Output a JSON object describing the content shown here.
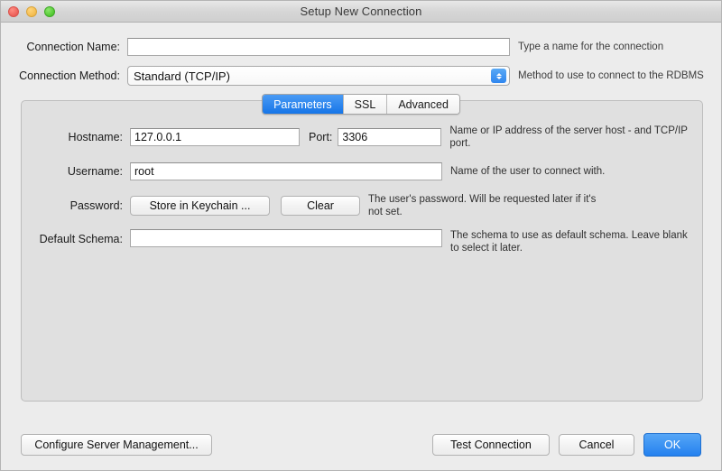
{
  "window": {
    "title": "Setup New Connection",
    "traffic_lights": [
      "close-button",
      "minimize-button",
      "maximize-button"
    ]
  },
  "form": {
    "connection_name": {
      "label": "Connection Name:",
      "value": "",
      "placeholder": "",
      "hint": "Type a name for the connection"
    },
    "connection_method": {
      "label": "Connection Method:",
      "value": "Standard (TCP/IP)",
      "hint": "Method to use to connect to the RDBMS",
      "options": [
        "Standard (TCP/IP)"
      ]
    }
  },
  "tabs": [
    {
      "label": "Parameters",
      "active": true
    },
    {
      "label": "SSL",
      "active": false
    },
    {
      "label": "Advanced",
      "active": false
    }
  ],
  "parameters": {
    "hostname": {
      "label": "Hostname:",
      "value": "127.0.0.1",
      "placeholder": ""
    },
    "port": {
      "label": "Port:",
      "value": "3306",
      "placeholder": "",
      "hint": "Name or IP address of the server host - and TCP/IP port."
    },
    "username": {
      "label": "Username:",
      "value": "root",
      "placeholder": "",
      "hint": "Name of the user to connect with."
    },
    "password": {
      "label": "Password:",
      "store_button": "Store in Keychain ...",
      "clear_button": "Clear",
      "hint": "The user's password. Will be requested later if it's not set."
    },
    "default_schema": {
      "label": "Default Schema:",
      "value": "",
      "placeholder": "",
      "hint": "The schema to use as default schema. Leave blank to select it later."
    }
  },
  "footer": {
    "configure_server": "Configure Server Management...",
    "test_connection": "Test Connection",
    "cancel": "Cancel",
    "ok": "OK"
  },
  "colors": {
    "accent_blue": "#2481ef",
    "tab_active_blue": "#1675e8",
    "window_background": "#ececec",
    "panel_background": "#e0e0e0"
  }
}
